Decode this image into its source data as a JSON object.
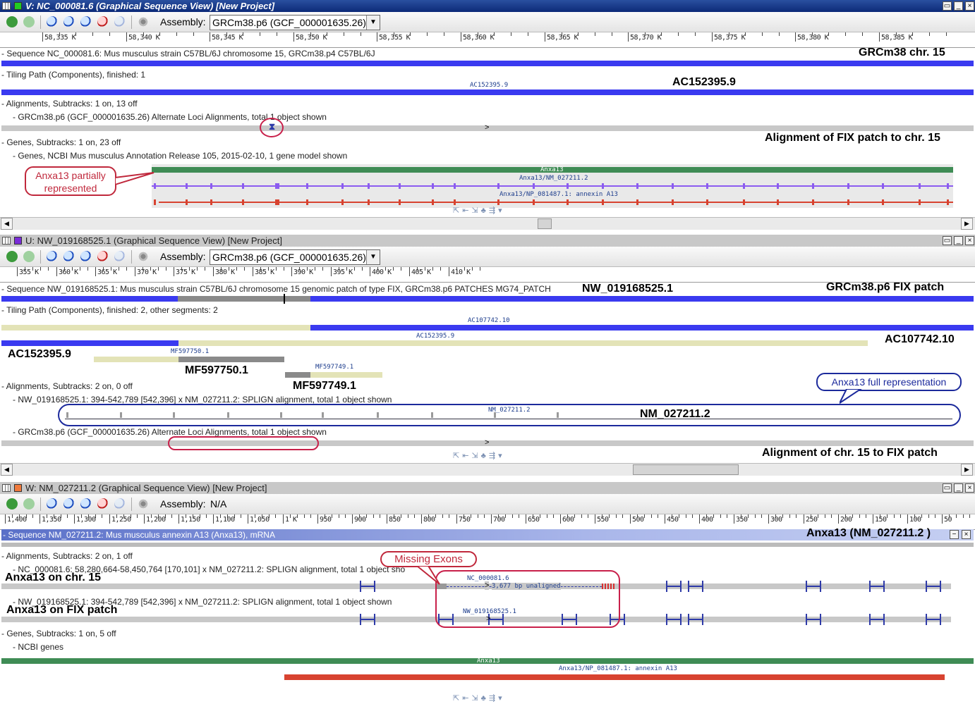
{
  "pane_v": {
    "title": "V: NC_000081.6 (Graphical Sequence View) [New Project]",
    "assembly_label": "Assembly:",
    "assembly_value": "GRCm38.p6 (GCF_000001635.26)",
    "ruler": [
      "58,335 K",
      "58,340 K",
      "58,345 K",
      "58,350 K",
      "58,355 K",
      "58,360 K",
      "58,365 K",
      "58,370 K",
      "58,375 K",
      "58,380 K",
      "58,385 K"
    ],
    "seq_header": "- Sequence NC_000081.6: Mus musculus strain C57BL/6J chromosome 15, GRCm38.p4 C57BL/6J",
    "seq_label": "GRCm38 chr. 15",
    "tiling_header": "- Tiling Path (Components), finished: 1",
    "tiling_bar_label": "AC152395.9",
    "tiling_big": "AC152395.9",
    "align_header": "- Alignments, Subtracks: 1 on, 13 off",
    "align_sub": "- GRCm38.p6 (GCF_000001635.26) Alternate Loci Alignments, total 1 object shown",
    "align_big": "Alignment of FIX patch to chr. 15",
    "genes_header": "- Genes, Subtracks: 1 on, 23 off",
    "genes_sub": "- Genes, NCBI Mus musculus Annotation Release 105, 2015-02-10, 1 gene model shown",
    "gene_label": "Anxa13",
    "mrna_label": "Anxa13/NM_027211.2",
    "cds_label": "Anxa13/NP_081487.1: annexin A13",
    "callout": "Anxa13 partially represented"
  },
  "pane_u": {
    "title": "U: NW_019168525.1 (Graphical Sequence View) [New Project]",
    "assembly_label": "Assembly:",
    "assembly_value": "GRCm38.p6 (GCF_000001635.26)",
    "ruler": [
      "355 K",
      "360 K",
      "365 K",
      "370 K",
      "375 K",
      "380 K",
      "385 K",
      "390 K",
      "395 K",
      "400 K",
      "405 K",
      "410 K"
    ],
    "seq_header": "- Sequence NW_019168525.1: Mus musculus strain C57BL/6J chromosome 15 genomic patch of type FIX, GRCm38.p6 PATCHES MG74_PATCH",
    "seq_big": "NW_019168525.1",
    "seq_label": "GRCm38.p6 FIX patch",
    "tiling_header": "- Tiling Path (Components), finished: 2, other segments: 2",
    "comp1_label": "AC107742.10",
    "comp2_label": "AC152395.9",
    "comp3_label": "MF597750.1",
    "comp4_label": "MF597749.1",
    "big_ac152": "AC152395.9",
    "big_ac107": "AC107742.10",
    "big_mf50": "MF597750.1",
    "big_mf49": "MF597749.1",
    "align_header": "- Alignments, Subtracks: 2 on, 0 off",
    "align_sub1": "- NW_019168525.1: 394-542,789 [542,396] x NM_027211.2: SPLIGN alignment, total 1 object shown",
    "nm_label": "NM_027211.2",
    "nm_big": "NM_027211.2",
    "align_sub2": "- GRCm38.p6 (GCF_000001635.26) Alternate Loci Alignments, total 1 object shown",
    "align_big": "Alignment of chr. 15 to FIX patch",
    "callout": "Anxa13 full representation"
  },
  "pane_w": {
    "title": "W: NM_027211.2 (Graphical Sequence View) [New Project]",
    "assembly_label": "Assembly:",
    "assembly_value": "N/A",
    "ruler": [
      "1,400",
      "1,350",
      "1,300",
      "1,250",
      "1,200",
      "1,150",
      "1,100",
      "1,050",
      "1 K",
      "950",
      "900",
      "850",
      "800",
      "750",
      "700",
      "650",
      "600",
      "550",
      "500",
      "450",
      "400",
      "350",
      "300",
      "250",
      "200",
      "150",
      "100",
      "50"
    ],
    "seq_header": "- Sequence NM_027211.2: Mus musculus annexin A13 (Anxa13), mRNA",
    "seq_big": "Anxa13 (NM_027211.2 )",
    "align_header": "- Alignments, Subtracks: 2 on, 1 off",
    "align_sub1": "- NC_000081.6: 58,280,664-58,450,764 [170,101] x NM_027211.2: SPLIGN alignment, total 1 object sho",
    "big_chr15": "Anxa13 on chr. 15",
    "nc_label": "NC_000081.6",
    "unaligned": "3,677 bp unaligned",
    "align_sub2": "- NW_019168525.1: 394-542,789 [542,396] x NM_027211.2: SPLIGN alignment, total 1 object shown",
    "big_fix": "Anxa13 on FIX patch",
    "nw_label": "NW_019168525.1",
    "genes_header": "- Genes, Subtracks: 1 on, 5 off",
    "genes_sub": "- NCBI genes",
    "gene_label": "Anxa13",
    "cds_label": "Anxa13/NP_081487.1: annexin A13",
    "callout": "Missing Exons"
  },
  "colors": {
    "active_title": "#1c3c8c",
    "sequence_bar": "#3a3af0",
    "gene": "#3f8c55",
    "mrna": "#8c5cf0",
    "cds": "#d84330",
    "callout_red": "#c0283c",
    "callout_blue": "#1c2a9c"
  }
}
